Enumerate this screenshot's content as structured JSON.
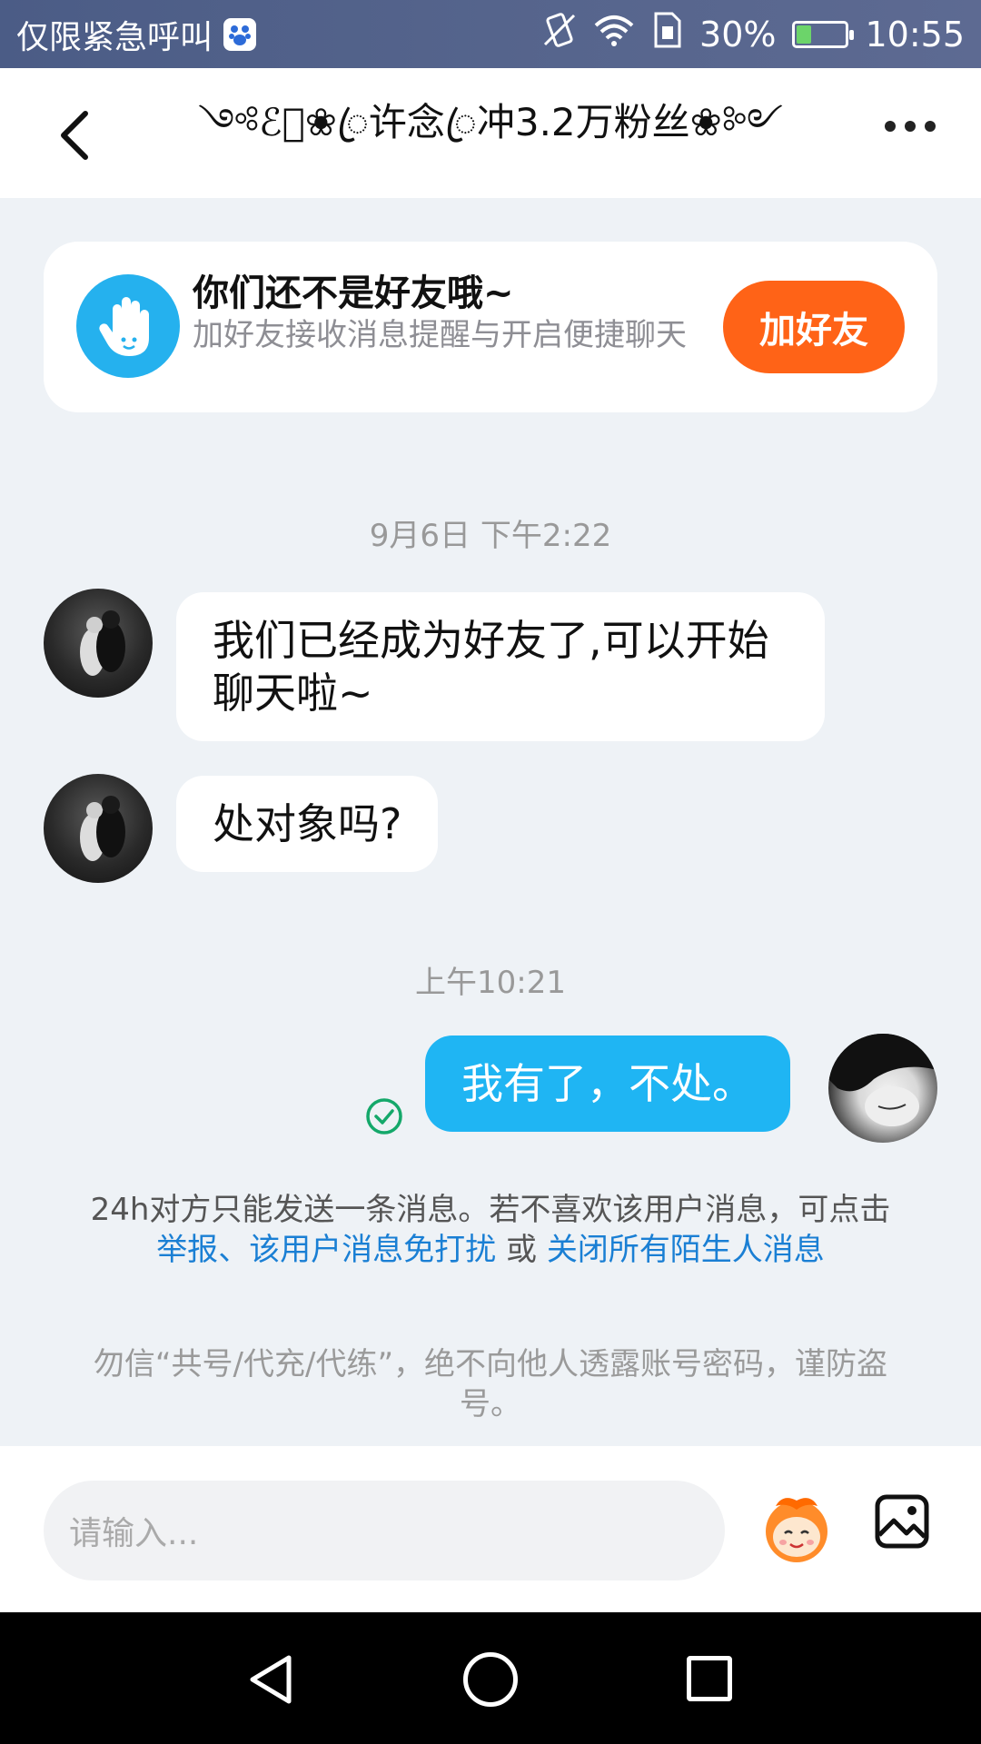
{
  "status_bar": {
    "carrier_text": "仅限紧急呼叫",
    "battery_percent": "30%",
    "battery_level": 0.3,
    "time": "10:55"
  },
  "header": {
    "title": "༺ℰ⃪❀ꦿ许念ꦿ冲3.2万粉丝❀༻"
  },
  "friend_card": {
    "title": "你们还不是好友哦~",
    "subtitle": "加好友接收消息提醒与开启便捷聊天",
    "button_label": "加好友"
  },
  "messages": [
    {
      "timestamp": "9月6日 下午2:22"
    },
    {
      "sender": "peer",
      "text": "我们已经成为好友了,可以开始聊天啦~"
    },
    {
      "sender": "peer",
      "text": "处对象吗?"
    },
    {
      "timestamp": "上午10:21"
    },
    {
      "sender": "me",
      "text": "我有了，不处。"
    }
  ],
  "notice": {
    "text": "24h对方只能发送一条消息。若不喜欢该用户消息，可点击",
    "link_report": "举报",
    "separator": "、",
    "link_mute": "该用户消息免打扰",
    "or_text": "或",
    "link_close": "关闭所有陌生人消息"
  },
  "warning": "勿信“共号/代充/代练”，绝不向他人透露账号密码，谨防盗号。",
  "input": {
    "placeholder": "请输入..."
  },
  "colors": {
    "accent_blue": "#1fb5f3",
    "add_friend_orange": "#ff6317",
    "link_blue": "#1a7fd4"
  }
}
